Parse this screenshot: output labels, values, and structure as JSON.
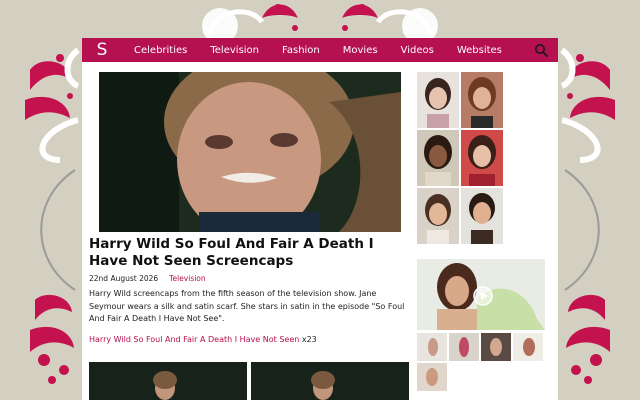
{
  "nav": {
    "logo": "S",
    "items": [
      "Celebrities",
      "Television",
      "Fashion",
      "Movies",
      "Videos",
      "Websites"
    ]
  },
  "post": {
    "title": "Harry Wild So Foul And Fair A Death I Have Not Seen Screencaps",
    "date": "22nd August 2026",
    "category": "Television",
    "excerpt": "Harry Wild screencaps from the fifth season of the television show. Jane Seymour wears a silk and satin scarf. She stars in satin in the episode \"So Foul And Fair A Death I Have Not See\".",
    "gallery_link": "Harry Wild So Foul And Fair A Death I Have Not Seen",
    "gallery_count": "x23"
  },
  "colors": {
    "brand": "#b5104f",
    "background": "#d3cfc1"
  },
  "icons": {
    "search": "search-icon",
    "play": "play-icon"
  }
}
